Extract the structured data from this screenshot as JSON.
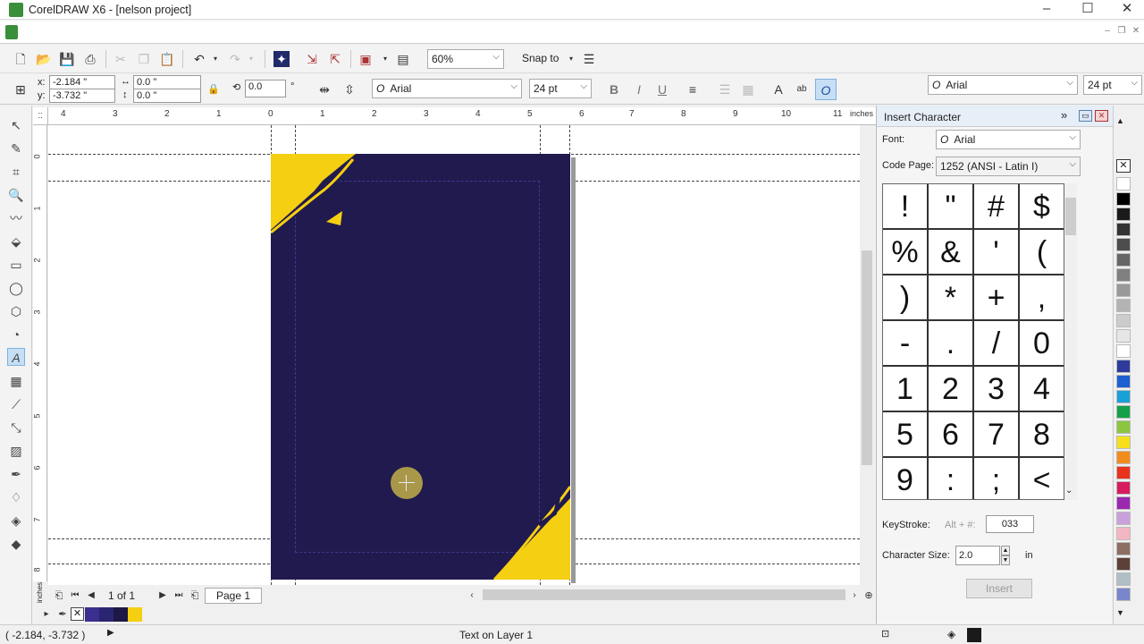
{
  "window": {
    "title": "CorelDRAW X6 - [nelson project]",
    "minimize": "–",
    "maximize": "☐",
    "close": "✕",
    "mdi_min": "–",
    "mdi_restore": "❐",
    "mdi_close": "✕"
  },
  "toolbar": {
    "zoom": "60%",
    "snap_to": "Snap to"
  },
  "property_bar": {
    "x_label": "x:",
    "x_value": "-2.184 \"",
    "y_label": "y:",
    "y_value": "-3.732 \"",
    "w_value": "0.0 \"",
    "h_value": "0.0 \"",
    "rotation": "0.0",
    "degree": "°",
    "font": "Arial",
    "font_size": "24 pt",
    "font_right": "Arial",
    "font_size_right": "24 pt"
  },
  "ruler": {
    "unit": "inches",
    "h_ticks": [
      "4",
      "3",
      "2",
      "1",
      "0",
      "1",
      "2",
      "3",
      "4",
      "5",
      "6",
      "7",
      "8",
      "9",
      "10",
      "11"
    ],
    "v_ticks": [
      "0",
      "1",
      "2",
      "3",
      "4",
      "5",
      "6",
      "7",
      "8"
    ],
    "v_unit": "inches"
  },
  "page_nav": {
    "current": "1 of 1",
    "tab": "Page 1"
  },
  "status": {
    "coords": "( -2.184, -3.732 )",
    "message": "Text on Layer 1"
  },
  "docker": {
    "title": "Insert Character",
    "font_label": "Font:",
    "font_value": "Arial",
    "codepage_label": "Code Page:",
    "codepage_value": "1252  (ANSI - Latin I)",
    "characters": [
      "!",
      "\"",
      "#",
      "$",
      "%",
      "&",
      "'",
      "(",
      ")",
      "*",
      "+",
      ",",
      "-",
      ".",
      "/",
      "0",
      "1",
      "2",
      "3",
      "4",
      "5",
      "6",
      "7",
      "8",
      "9",
      ":",
      ";",
      "<"
    ],
    "keystroke_label": "KeyStroke:",
    "keystroke_hint": "Alt +  #:",
    "keystroke_value": "033",
    "size_label": "Character Size:",
    "size_value": "2.0",
    "size_unit": "in",
    "insert_button": "Insert"
  },
  "colors": {
    "page_bg": "#211a4e",
    "accent_yellow": "#f5cf12",
    "document_palette": [
      "#3a2f8f",
      "#2a2570",
      "#1d1845",
      "#f5cf12"
    ],
    "palette": [
      "#ffffff",
      "#000000",
      "#1a1a1a",
      "#333333",
      "#4d4d4d",
      "#666666",
      "#808080",
      "#999999",
      "#b3b3b3",
      "#cccccc",
      "#e6e6e6",
      "#ffffff",
      "#2f3b9c",
      "#1b5fd1",
      "#1aa0d8",
      "#14a04a",
      "#8cc63f",
      "#f7e01b",
      "#f28c1d",
      "#e8321c",
      "#d81b60",
      "#9c27b0",
      "#c9a0dc",
      "#f4b6c2",
      "#8d6e63",
      "#5d4037",
      "#b0bec5",
      "#7986cb"
    ]
  }
}
